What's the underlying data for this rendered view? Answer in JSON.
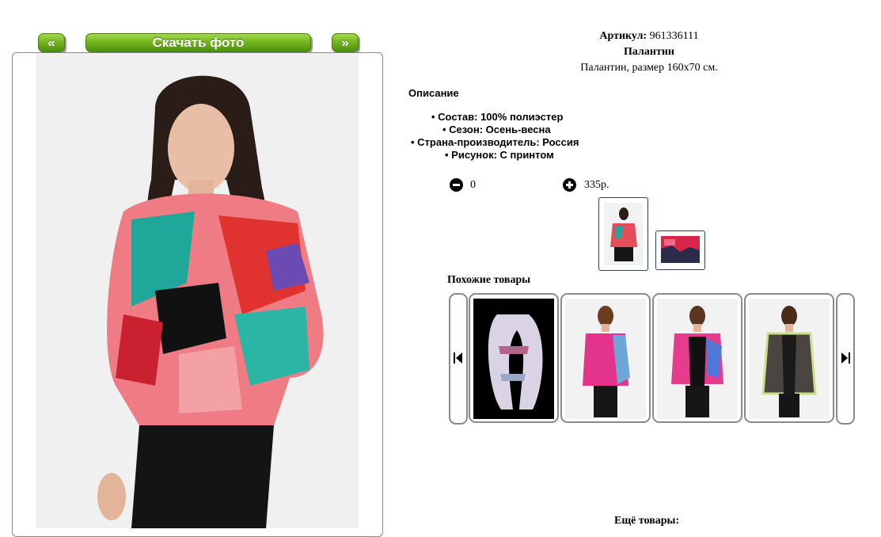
{
  "nav": {
    "prev_label": "«",
    "download_label": "Скачать фото",
    "next_label": "»"
  },
  "product": {
    "sku_label": "Артикул:",
    "sku_value": "961336111",
    "name": "Палантин",
    "description": "Палантин, размер 160x70 см."
  },
  "description": {
    "heading": "Описание",
    "specs": [
      "• Состав: 100% полиэстер",
      "• Сезон: Осень-весна",
      "• Страна-производитель: Россия",
      "• Рисунок: С принтом"
    ]
  },
  "order": {
    "quantity": "0",
    "price": "335р."
  },
  "similar": {
    "heading": "Похожие товары"
  },
  "more": {
    "heading": "Ещё товары:"
  },
  "colors": {
    "button_green": "#6fb21d",
    "frame_border": "#8a8a8a",
    "thumb_border": "#33435a"
  }
}
